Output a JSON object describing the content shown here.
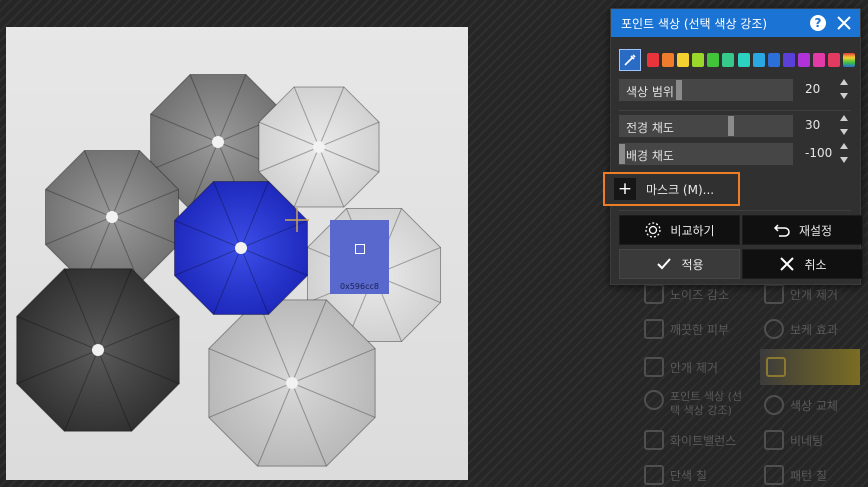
{
  "panel": {
    "title": "포인트 색상 (선택 색상 강조)",
    "help_label": "?",
    "colors": [
      "#e8343a",
      "#f17c2c",
      "#f4d130",
      "#9bd62a",
      "#41c33a",
      "#36c98a",
      "#2bd2c2",
      "#2aa8e2",
      "#2b6fd8",
      "#5a3fd8",
      "#b032d9",
      "#e33aa8",
      "#e33a62"
    ],
    "sliders": [
      {
        "label": "색상 범위",
        "value": "20",
        "level_pct": 34
      },
      {
        "label": "전경 채도",
        "value": "30",
        "level_pct": 65
      },
      {
        "label": "배경 채도",
        "value": "-100",
        "level_pct": 0
      }
    ],
    "mask_label": "마스크 (M)...",
    "buttons": {
      "compare": "비교하기",
      "reset": "재설정",
      "apply": "적용",
      "cancel": "취소"
    }
  },
  "canvas": {
    "swatch_hex": "0x596cc8",
    "accent_color": "#5968cc"
  },
  "tools": [
    {
      "label": "노이즈 감소"
    },
    {
      "label": "안개 제거"
    },
    {
      "label": "깨끗한 피부"
    },
    {
      "label": "보케 효과"
    },
    {
      "label": "안개 제거"
    },
    {
      "label": "색상 교체"
    },
    {
      "label": "포인트 색상 (선택 색상 강조)"
    },
    {
      "label": "화이트밸런스"
    },
    {
      "label": "비네팅"
    },
    {
      "label": "단색 칠"
    },
    {
      "label": "패턴 칠"
    }
  ]
}
